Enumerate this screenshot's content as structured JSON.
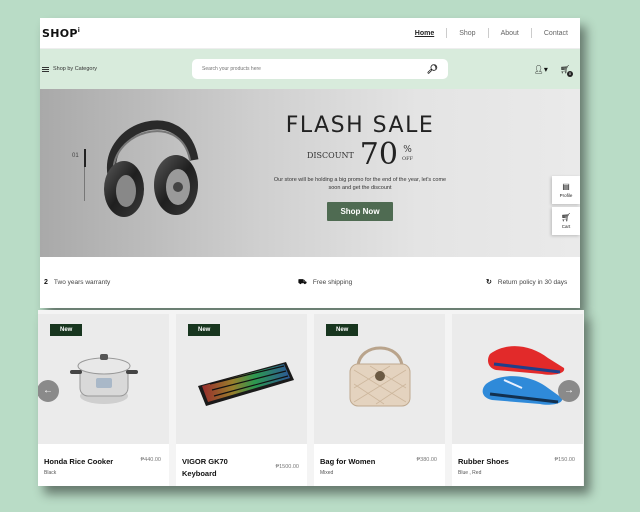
{
  "brand": {
    "logo": "SHOP",
    "logo_mark": "i"
  },
  "nav": {
    "links": [
      "Home",
      "Shop",
      "About",
      "Contact"
    ],
    "active": "Home"
  },
  "searchbar": {
    "category_label": "Shop by Category",
    "placeholder": "Search your products here",
    "icons": [
      "search-icon",
      "user-icon",
      "cart-icon"
    ],
    "cart_count": "0"
  },
  "hero": {
    "slide_index": "01",
    "title": "FLASH SALE",
    "discount_word": "DISCOUNT",
    "discount_value": "70",
    "discount_symbol": "%",
    "discount_off": "OFF",
    "promo_text": "Our store will be holding a big promo for the end of the year, let's come soon and get the discount",
    "cta": "Shop Now"
  },
  "side_tabs": [
    {
      "label": "Profile",
      "icon": "profile-icon"
    },
    {
      "label": "Cart",
      "icon": "cart-icon"
    }
  ],
  "features": [
    {
      "label": "Two years warranty",
      "icon_text": "2"
    },
    {
      "label": "Free shipping",
      "icon": "truck-icon"
    },
    {
      "label": "Return policy in 30 days",
      "icon": "return-icon"
    }
  ],
  "products": [
    {
      "badge": "New",
      "name": "Honda Rice Cooker",
      "price": "₱440.00",
      "variant": "Black"
    },
    {
      "badge": "New",
      "name": "VIGOR GK70 Keyboard",
      "price": "₱1500.00",
      "variant": ""
    },
    {
      "badge": "New",
      "name": "Bag for Women",
      "price": "₱380.00",
      "variant": "Mixed"
    },
    {
      "badge": "",
      "name": "Rubber Shoes",
      "price": "₱150.00",
      "variant": "Blue , Red"
    }
  ],
  "colors": {
    "page_bg": "#b9dcc6",
    "search_row_bg": "#d8ebdc",
    "accent_dark_green": "#18361f",
    "cta_green": "#4f6b52"
  }
}
